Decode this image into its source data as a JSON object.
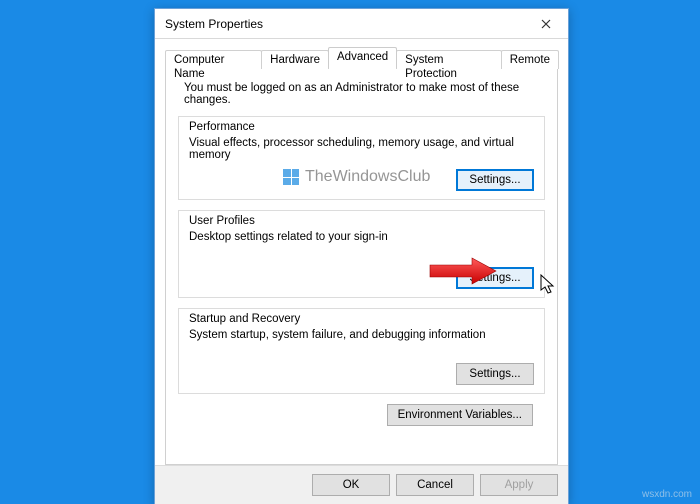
{
  "window": {
    "title": "System Properties"
  },
  "tabs": {
    "t0": "Computer Name",
    "t1": "Hardware",
    "t2": "Advanced",
    "t3": "System Protection",
    "t4": "Remote"
  },
  "panel": {
    "note": "You must be logged on as an Administrator to make most of these changes.",
    "perf": {
      "legend": "Performance",
      "desc": "Visual effects, processor scheduling, memory usage, and virtual memory",
      "btn": "Settings..."
    },
    "profiles": {
      "legend": "User Profiles",
      "desc": "Desktop settings related to your sign-in",
      "btn": "Settings..."
    },
    "startup": {
      "legend": "Startup and Recovery",
      "desc": "System startup, system failure, and debugging information",
      "btn": "Settings..."
    },
    "env_btn": "Environment Variables..."
  },
  "bottom": {
    "ok": "OK",
    "cancel": "Cancel",
    "apply": "Apply"
  },
  "watermark": "TheWindowsClub",
  "attribution": "wsxdn.com"
}
